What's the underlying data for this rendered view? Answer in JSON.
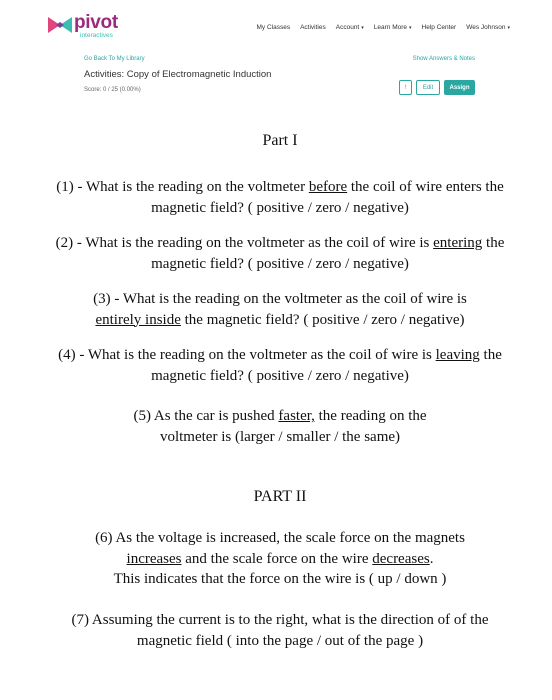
{
  "header": {
    "logo": {
      "name": "pivot",
      "subtitle": "interactives"
    },
    "nav": [
      {
        "label": "My Classes",
        "dropdown": false
      },
      {
        "label": "Activities",
        "dropdown": false
      },
      {
        "label": "Account",
        "dropdown": true
      },
      {
        "label": "Learn More",
        "dropdown": true
      },
      {
        "label": "Help Center",
        "dropdown": false
      },
      {
        "label": "Wes Johnson",
        "dropdown": true
      }
    ]
  },
  "activity": {
    "back_link": "Go Back To My Library",
    "show_answers": "Show Answers & Notes",
    "title": "Activities: Copy of Electromagnetic Induction",
    "score": "Score: 0 / 25 (0.00%)",
    "buttons": {
      "info": "!",
      "edit": "Edit",
      "assign": "Assign"
    }
  },
  "document": {
    "part1": "Part I",
    "q1": {
      "a": "(1) - What is the reading on the voltmeter ",
      "u": "before",
      "b": " the coil of wire enters the",
      "line2": "magnetic field?  ( positive / zero / negative)"
    },
    "q2": {
      "a": "(2) - What is the reading on the voltmeter as the coil of wire is ",
      "u": "entering",
      "b": " the",
      "line2": "magnetic field?  ( positive / zero / negative)"
    },
    "q3": {
      "line1": "(3) - What is the reading on the voltmeter as the coil of wire is",
      "u": "entirely inside",
      "b": " the magnetic field?  ( positive / zero / negative)"
    },
    "q4": {
      "a": "(4) - What is the reading on the voltmeter as the coil of wire is ",
      "u": "leaving",
      "b": " the",
      "line2": "magnetic field?  ( positive / zero / negative)"
    },
    "q5": {
      "a": "(5)  As the car is pushed ",
      "u": "faster,",
      "b": " the reading on the",
      "line2": "voltmeter is  (larger / smaller  /  the same)"
    },
    "part2": "PART II",
    "q6": {
      "line1": "(6)  As the voltage is increased, the scale force on the magnets",
      "u1": "increases",
      "mid": " and the scale force on the wire ",
      "u2": "decreases",
      "end": ".",
      "line3": "This indicates that the force on the wire is ( up / down )"
    },
    "q7": {
      "line1": "(7)  Assuming the current is to the right, what is the direction of of the",
      "line2": "magnetic field  ( into the page  /  out of the page )"
    }
  },
  "colors": {
    "brand_purple": "#9b2a7e",
    "accent_teal": "#2aa7a0"
  }
}
